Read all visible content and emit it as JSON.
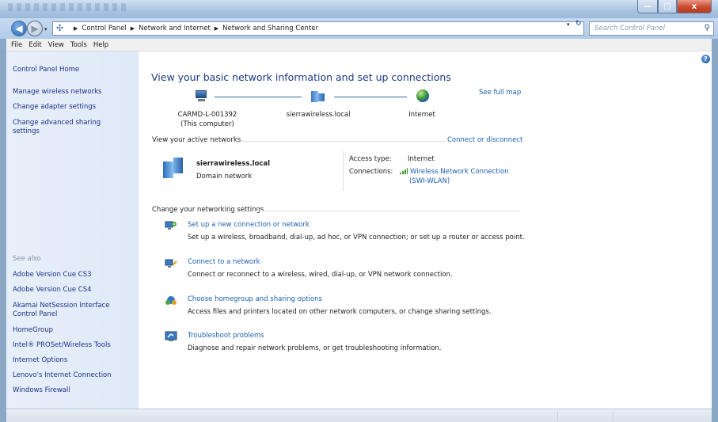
{
  "window": {
    "minimize_glyph": "—",
    "maximize_glyph": "□",
    "close_glyph": "x"
  },
  "nav": {
    "back_glyph": "◀",
    "forward_glyph": "▶",
    "breadcrumb": [
      "Control Panel",
      "Network and Internet",
      "Network and Sharing Center"
    ],
    "search_placeholder": "Search Control Panel"
  },
  "menu": [
    "File",
    "Edit",
    "View",
    "Tools",
    "Help"
  ],
  "sidebar": {
    "home": "Control Panel Home",
    "items": [
      "Manage wireless networks",
      "Change adapter settings",
      "Change advanced sharing settings"
    ],
    "see_also_label": "See also",
    "see_also": [
      "Adobe Version Cue CS3",
      "Adobe Version Cue CS4",
      "Akamai NetSession Interface Control Panel",
      "HomeGroup",
      "Intel® PROSet/Wireless Tools",
      "Internet Options",
      "Lenovo's Internet Connection",
      "Windows Firewall"
    ]
  },
  "main": {
    "help_glyph": "?",
    "heading": "View your basic network information and set up connections",
    "see_full_map": "See full map",
    "computer_name": "CARMD-L-001392",
    "computer_sub": "(This computer)",
    "domain_node": "sierrawireless.local",
    "internet_node": "Internet",
    "active_networks_title": "View your active networks",
    "connect_disconnect": "Connect or disconnect",
    "active_network": {
      "name": "sierrawireless.local",
      "type": "Domain network",
      "access_type_label": "Access type:",
      "access_type_value": "Internet",
      "connections_label": "Connections:",
      "connection_name_line1": "Wireless Network Connection",
      "connection_name_line2": "(SWI-WLAN)"
    },
    "change_settings_title": "Change your networking settings",
    "tasks": [
      {
        "title": "Set up a new connection or network",
        "desc": "Set up a wireless, broadband, dial-up, ad hoc, or VPN connection; or set up a router or access point."
      },
      {
        "title": "Connect to a network",
        "desc": "Connect or reconnect to a wireless, wired, dial-up, or VPN network connection."
      },
      {
        "title": "Choose homegroup and sharing options",
        "desc": "Access files and printers located on other network computers, or change sharing settings."
      },
      {
        "title": "Troubleshoot problems",
        "desc": "Diagnose and repair network problems, or get troubleshooting information."
      }
    ]
  },
  "colors": {
    "link": "#1a5fb4",
    "heading": "#1c3a84",
    "sidebar_link": "#1e3287"
  }
}
